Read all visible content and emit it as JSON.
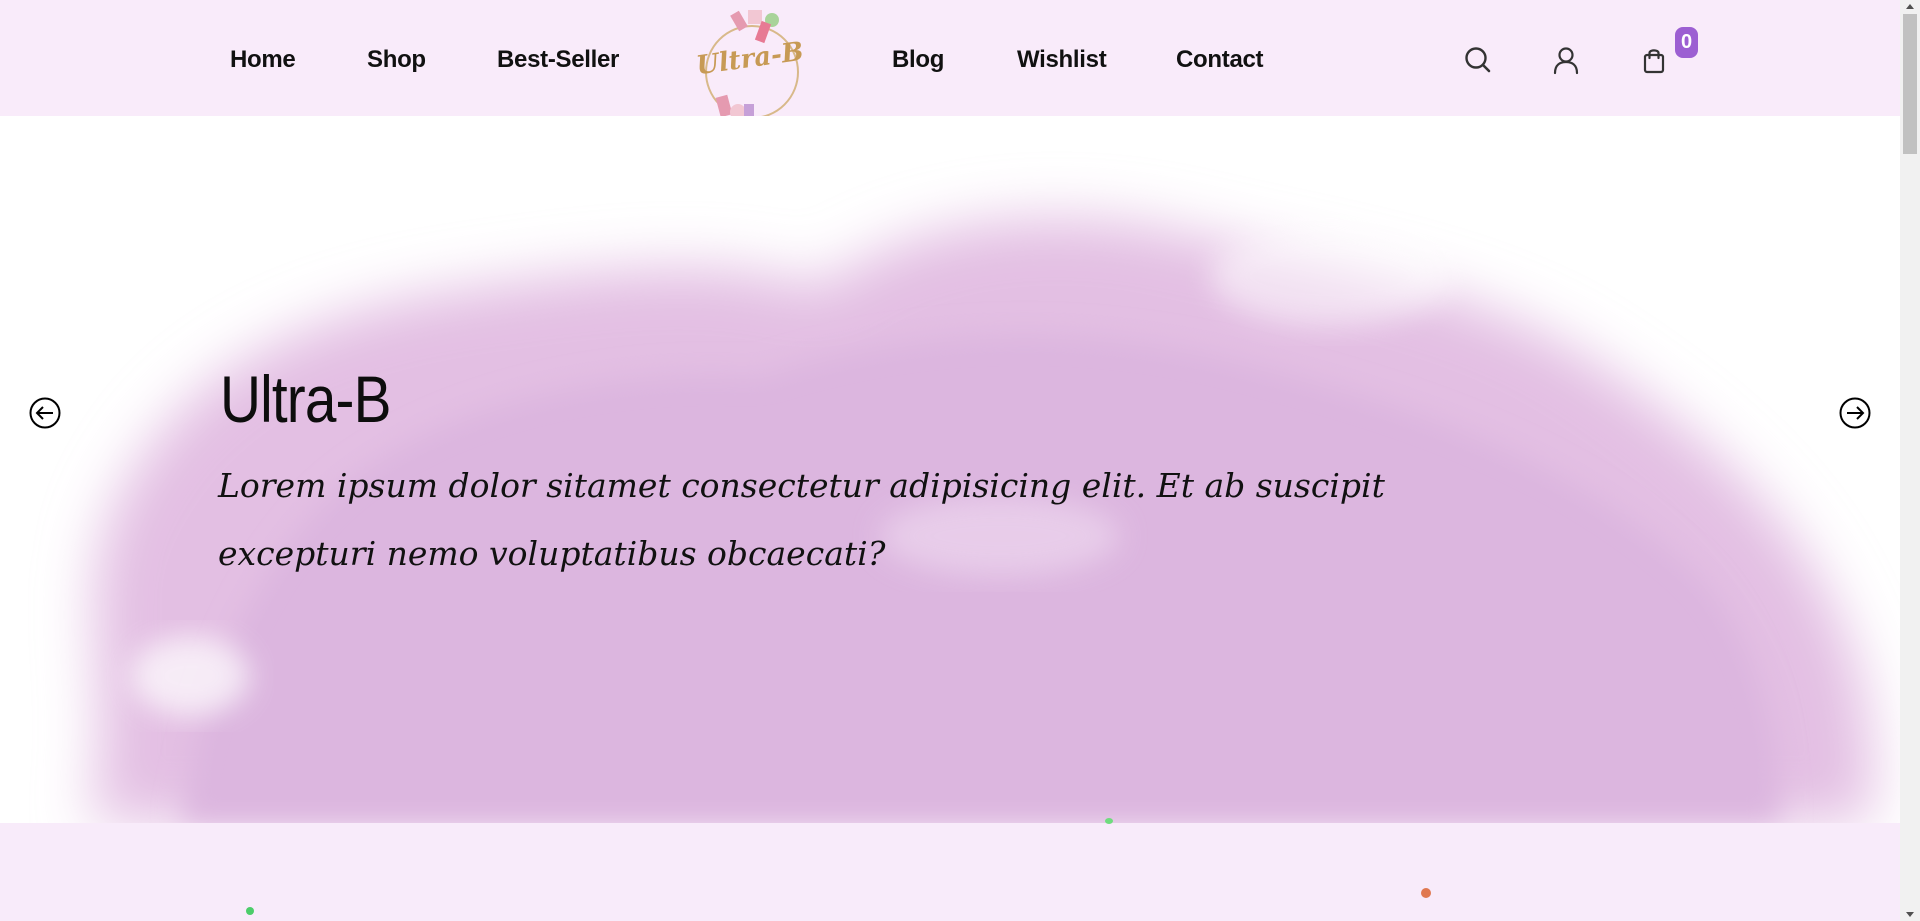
{
  "nav": {
    "left": [
      "Home",
      "Shop",
      "Best-Seller"
    ],
    "right": [
      "Blog",
      "Wishlist",
      "Contact"
    ]
  },
  "logo": {
    "text": "Ultra-B"
  },
  "icons": {
    "search": "search-icon",
    "account": "user-icon",
    "cart": "shopping-bag-icon",
    "prev": "arrow-left-circle-icon",
    "next": "arrow-right-circle-icon"
  },
  "cart": {
    "count": "0"
  },
  "hero": {
    "title": "Ultra-B",
    "text": "Lorem ipsum dolor sitamet consectetur adipisicing elit. Et ab suscipit excepturi nemo voluptatibus obcaecati?"
  },
  "colors": {
    "header_bg": "#f9ebfa",
    "badge": "#9c5fd2",
    "watercolor": "#e0bde1"
  }
}
